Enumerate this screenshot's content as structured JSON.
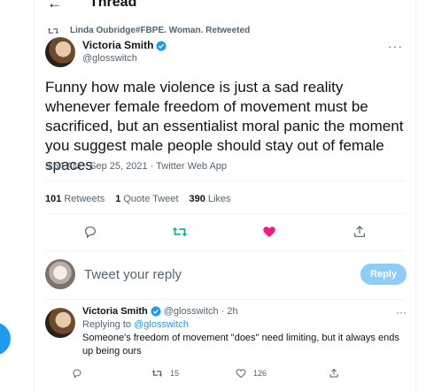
{
  "header": {
    "title": "Thread",
    "back_icon": "back-arrow-icon"
  },
  "retweet_context": {
    "text": "Linda Oubridge#FBPE. Woman. Retweeted",
    "icon": "retweet-icon"
  },
  "main_tweet": {
    "display_name": "Victoria Smith",
    "handle": "@glosswitch",
    "verified": true,
    "text": "Funny how male violence is just a sad reality whenever female freedom of movement must be sacrificed, but an essentialist moral panic the moment you suggest male people should stay out of female spaces",
    "timestamp": "9:54 AM · Sep 25, 2021 · Twitter Web App",
    "more_label": "···"
  },
  "stats": {
    "retweets_count": "101",
    "retweets_label": "Retweets",
    "quote_count": "1",
    "quote_label": "Quote Tweet",
    "likes_count": "390",
    "likes_label": "Likes"
  },
  "actions": {
    "reply_icon": "reply-icon",
    "retweet_icon": "retweet-icon",
    "like_icon": "heart-icon",
    "share_icon": "share-icon",
    "retweet_color": "#00ba7c",
    "like_color": "#f91880"
  },
  "composer": {
    "placeholder": "Tweet your reply",
    "button_label": "Reply"
  },
  "reply": {
    "display_name": "Victoria Smith",
    "handle": "@glosswitch",
    "time": "2h",
    "replying_to_label": "Replying to",
    "replying_to_handle": "@glosswitch",
    "text": "Someone's freedom of movement \"does\" need limiting, but it always ends up being ours",
    "retweet_count": "15",
    "like_count": "126",
    "more_label": "···"
  },
  "colors": {
    "accent": "#1d9bf0",
    "reply_button_disabled": "#8ecdf8",
    "secondary_text": "#536471"
  }
}
